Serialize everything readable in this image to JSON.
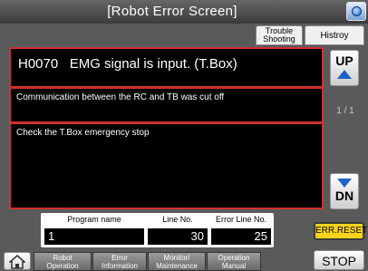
{
  "title": "[Robot Error Screen]",
  "header_tabs": {
    "trouble_shooting": "Trouble\nShooting",
    "history": "Histroy"
  },
  "error": {
    "code_line": "H0070   EMG signal is input. (T.Box)",
    "cause": "Communication between the RC and TB was cut off",
    "remedy": "Check the T.Box emergency stop"
  },
  "nav": {
    "up": "UP",
    "down": "DN",
    "page_indicator": "1 / 1"
  },
  "info": {
    "program_name_label": "Program name",
    "program_name_value": "1",
    "line_no_label": "Line No.",
    "line_no_value": "30",
    "error_line_label": "Error Line No.",
    "error_line_value": "25"
  },
  "buttons": {
    "err_reset": "ERR.RESET",
    "stop": "STOP"
  },
  "footer_tabs": [
    {
      "label": "Robot\nOperation"
    },
    {
      "label": "Error\nInformation"
    },
    {
      "label": "Monitor/\nMaintenance"
    },
    {
      "label": "Operation\nManual"
    }
  ],
  "colors": {
    "border_red": "#d03030",
    "reset_yellow": "#ffd41a",
    "help_blue": "#1c63c7"
  }
}
